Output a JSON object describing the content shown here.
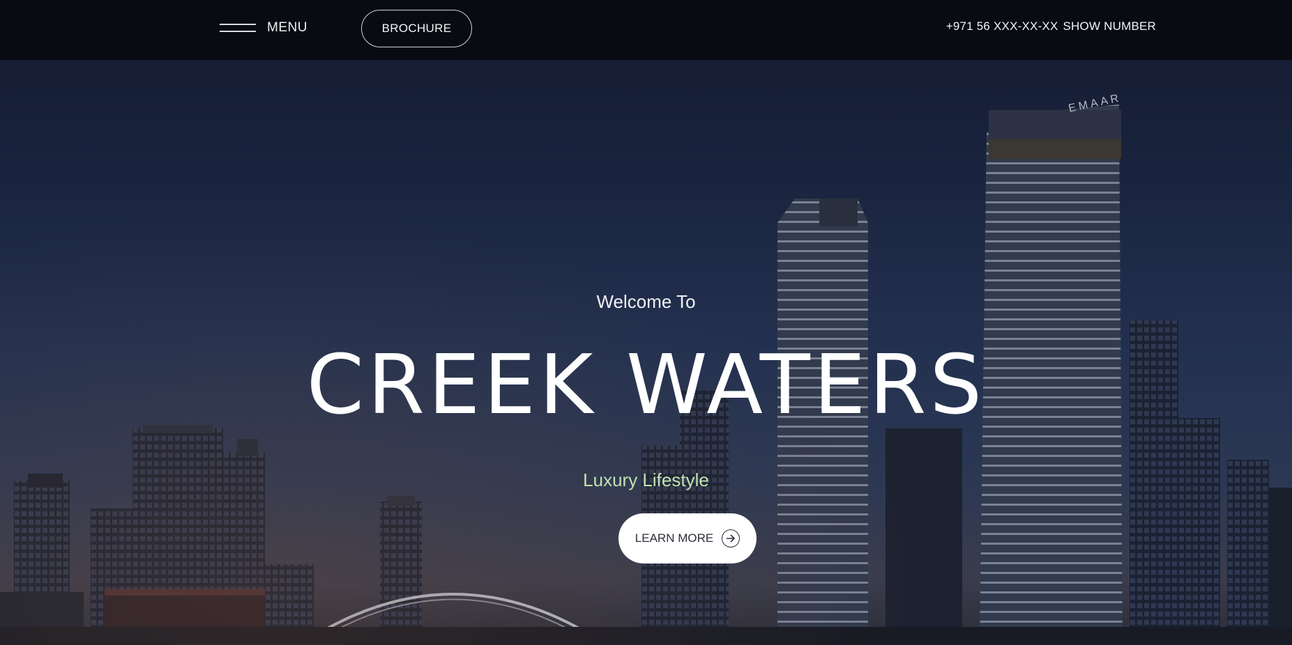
{
  "header": {
    "menu_label": "MENU",
    "brochure_label": "BROCHURE",
    "phone": "+971 56 XXX-XX-XX",
    "show_number_label": "SHOW NUMBER"
  },
  "hero": {
    "welcome": "Welcome To",
    "title": "CREEK WATERS",
    "tagline": "Luxury Lifestyle",
    "cta_label": "LEARN MORE",
    "tower_sign": "EMAAR"
  },
  "icons": {
    "menu": "hamburger-icon",
    "cta": "arrow-right-circle-icon"
  },
  "colors": {
    "topbar": "#080b12",
    "tagline": "#bfe3b0",
    "cta_bg": "#ffffff"
  }
}
